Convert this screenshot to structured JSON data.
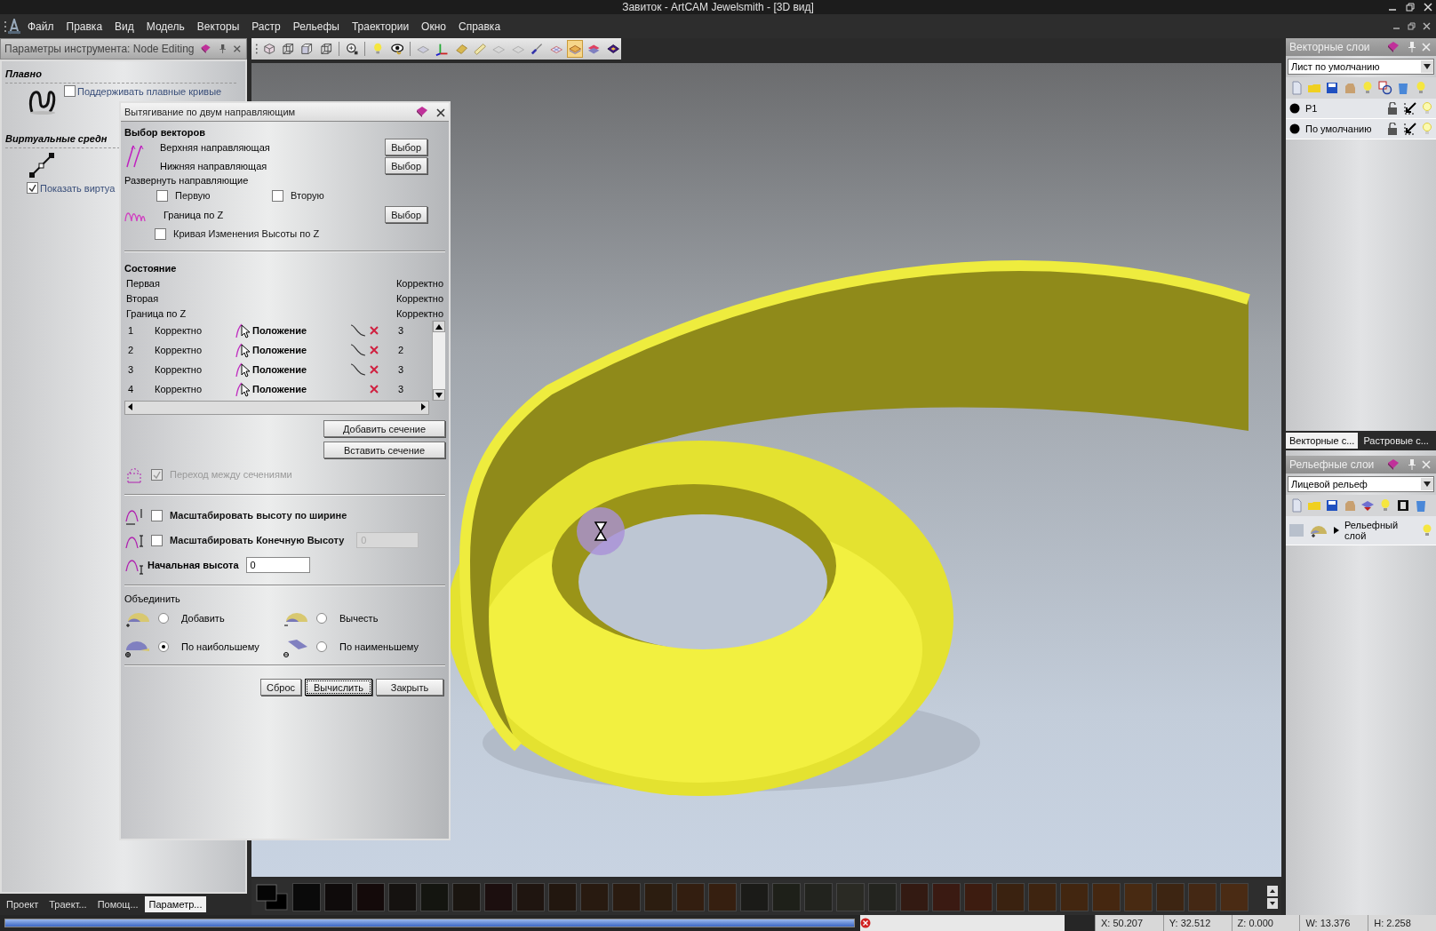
{
  "window": {
    "title": "Завиток - ArtCAM Jewelsmith - [3D вид]"
  },
  "menu": [
    "Файл",
    "Правка",
    "Вид",
    "Модель",
    "Векторы",
    "Растр",
    "Рельефы",
    "Траектории",
    "Окно",
    "Справка"
  ],
  "tool_panel": {
    "title": "Параметры инструмента: Node Editing",
    "sections": [
      {
        "heading": "Плавно",
        "kind": "loop",
        "checkbox": {
          "label": "Поддерживать плавные кривые",
          "checked": false
        }
      },
      {
        "heading": "Виртуальные средн",
        "kind": "segment",
        "checkbox": {
          "label": "Показать виртуа",
          "checked": true
        }
      }
    ]
  },
  "toolbar": [
    [
      {
        "kind": "cube",
        "selected": false
      },
      {
        "kind": "wire",
        "selected": false
      },
      {
        "kind": "box",
        "selected": false
      },
      {
        "kind": "wire",
        "selected": false
      }
    ],
    [
      {
        "kind": "zoom",
        "selected": false
      }
    ],
    [
      {
        "kind": "bulb",
        "selected": false
      },
      {
        "kind": "eye",
        "selected": false
      }
    ],
    [
      {
        "kind": "plane",
        "selected": false
      },
      {
        "kind": "axes",
        "selected": false
      },
      {
        "kind": "tile",
        "selected": false
      },
      {
        "kind": "ruler",
        "selected": false
      },
      {
        "kind": "plate",
        "selected": false
      },
      {
        "kind": "plate",
        "selected": false
      },
      {
        "kind": "brush",
        "selected": false
      },
      {
        "kind": "grid",
        "selected": false
      },
      {
        "kind": "layered",
        "selected": true
      },
      {
        "kind": "stack",
        "selected": false
      },
      {
        "kind": "diamond",
        "selected": false
      }
    ]
  ],
  "dialog": {
    "title": "Вытягивание по двум направляющим",
    "vector_heading": "Выбор векторов",
    "rails": [
      {
        "label": "Верхняя направляющая",
        "button": "Выбор"
      },
      {
        "label": "Нижняя направляющая",
        "button": "Выбор"
      }
    ],
    "reverse_label": "Развернуть направляющие",
    "reverse": [
      {
        "label": "Первую",
        "checked": false
      },
      {
        "label": "Вторую",
        "checked": false
      }
    ],
    "z_boundary": {
      "label": "Граница по Z",
      "button": "Выбор"
    },
    "z_curve": {
      "label": "Кривая Изменения Высоты по Z",
      "checked": false
    },
    "state_heading": "Состояние",
    "states": [
      {
        "name": "Первая",
        "value": "Корректно"
      },
      {
        "name": "Вторая",
        "value": "Корректно"
      },
      {
        "name": "Граница по Z",
        "value": "Корректно"
      }
    ],
    "sections": [
      {
        "number": "1",
        "status": "Корректно",
        "label": "Положение",
        "has_curve": true,
        "column_7": "3"
      },
      {
        "number": "2",
        "status": "Корректно",
        "label": "Положение",
        "has_curve": true,
        "column_7": "2"
      },
      {
        "number": "3",
        "status": "Корректно",
        "label": "Положение",
        "has_curve": true,
        "column_7": "3"
      },
      {
        "number": "4",
        "status": "Корректно",
        "label": "Положение",
        "has_curve": false,
        "column_7": "3"
      }
    ],
    "section_buttons": [
      "Добавить сечение",
      "Вставить сечение"
    ],
    "transition": {
      "label": "Переход между сечениями",
      "checked": true,
      "disabled": true
    },
    "scale_width": {
      "label": "Масштабировать высоту по ширине",
      "checked": false
    },
    "scale_end": {
      "label": "Масштабировать Конечную Высоту",
      "checked": false,
      "value": "0"
    },
    "start_height": {
      "label": "Начальная высота",
      "value": "0"
    },
    "combine_label": "Объединить",
    "combine": [
      {
        "label": "Добавить",
        "selected": false,
        "kind": "add"
      },
      {
        "label": "Вычесть",
        "selected": false,
        "kind": "subtract"
      },
      {
        "label": "По наибольшему",
        "selected": true,
        "kind": "max"
      },
      {
        "label": "По наименьшему",
        "selected": false,
        "kind": "min"
      }
    ],
    "buttons": [
      {
        "label": "Сброс",
        "default": false
      },
      {
        "label": "Вычислить",
        "default": true
      },
      {
        "label": "Закрыть",
        "default": false
      }
    ]
  },
  "vector_layers": {
    "title": "Векторные слои",
    "dropdown": "Лист по умолчанию",
    "layers": [
      {
        "name": "P1"
      },
      {
        "name": "По умолчанию"
      }
    ],
    "tabs": [
      {
        "label": "Векторные с...",
        "selected": true
      },
      {
        "label": "Растровые с...",
        "selected": false
      }
    ]
  },
  "relief_layers": {
    "title": "Рельефные слои",
    "dropdown": "Лицевой рельеф",
    "layers": [
      {
        "name": "Рельефный слой"
      }
    ]
  },
  "bottom_tabs": [
    {
      "label": "Проект",
      "selected": false
    },
    {
      "label": "Траект...",
      "selected": false
    },
    {
      "label": "Помощ...",
      "selected": false
    },
    {
      "label": "Параметр...",
      "selected": true
    }
  ],
  "palette": [
    {
      "color": "#0a0a0a"
    },
    {
      "color": "#0f0b0b"
    },
    {
      "color": "#140a0a"
    },
    {
      "color": "#151210"
    },
    {
      "color": "#141510"
    },
    {
      "color": "#1a1510"
    },
    {
      "color": "#1c0f0f"
    },
    {
      "color": "#1f1510"
    },
    {
      "color": "#22170f"
    },
    {
      "color": "#281a10"
    },
    {
      "color": "#2a1b10"
    },
    {
      "color": "#2c1d10"
    },
    {
      "color": "#331e10"
    },
    {
      "color": "#361f10"
    },
    {
      "color": "#1b1b18"
    },
    {
      "color": "#1e2019"
    },
    {
      "color": "#22231e"
    },
    {
      "color": "#2a2a24"
    },
    {
      "color": "#23241f"
    },
    {
      "color": "#331a12"
    },
    {
      "color": "#3a1a12"
    },
    {
      "color": "#3d1c10"
    },
    {
      "color": "#3a2210"
    },
    {
      "color": "#3e2410"
    },
    {
      "color": "#422610"
    },
    {
      "color": "#452710"
    },
    {
      "color": "#482a12"
    },
    {
      "color": "#3d2512"
    },
    {
      "color": "#442814"
    },
    {
      "color": "#4a2b14"
    }
  ],
  "status_bar": {
    "progress": {
      "level": 1
    },
    "coordinates": [
      "X: 50.207",
      "Y: 32.512",
      "Z: 0.000",
      "W: 13.376",
      "H: 2.258"
    ]
  }
}
